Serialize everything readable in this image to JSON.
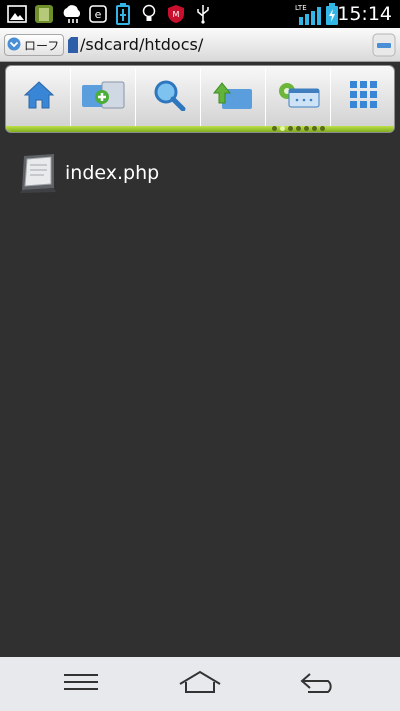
{
  "status_bar": {
    "time": "15:14",
    "network_type": "LTE",
    "icons": [
      "gallery-icon",
      "app-icon",
      "cloud-upload-icon",
      "browser-icon",
      "battery-saver-icon",
      "lightbulb-icon",
      "mcafee-icon",
      "usb-icon",
      "signal-icon",
      "battery-charging-icon"
    ],
    "accent_color": "#33b5e5"
  },
  "path_bar": {
    "location_label": "ローフ",
    "current_path": "/sdcard/htdocs/"
  },
  "toolbar": {
    "buttons": [
      "home-icon",
      "new-folder-icon",
      "search-icon",
      "up-folder-icon",
      "settings-window-icon",
      "grid-icon"
    ],
    "page_indicator": {
      "count": 7,
      "active": 1
    },
    "accent_color": "#9bc82e"
  },
  "files": [
    {
      "name": "index.php",
      "icon": "document-icon"
    }
  ],
  "nav_bar": {
    "buttons": [
      "menu-icon",
      "home-icon",
      "back-icon"
    ]
  }
}
